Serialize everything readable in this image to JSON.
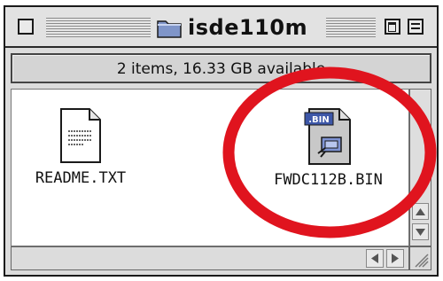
{
  "window": {
    "title": "isde110m",
    "info": "2 items, 16.33 GB available"
  },
  "files": [
    {
      "name": "README.TXT",
      "icon": "text-document-icon"
    },
    {
      "name": "FWDC112B.BIN",
      "icon": "bin-file-icon",
      "badge": ".BIN"
    }
  ],
  "annotation": {
    "color": "#e0141e",
    "shape": "ellipse"
  }
}
